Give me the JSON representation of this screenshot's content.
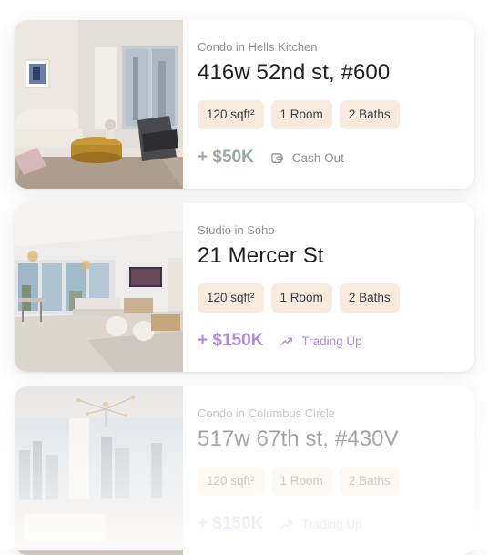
{
  "listings": [
    {
      "type": "Condo in Hells Kitchen",
      "address": "416w 52nd st, #600",
      "area": "120 sqft²",
      "rooms": "1 Room",
      "baths": "2 Baths",
      "amount": "+ $50K",
      "action": "Cash Out",
      "action_icon": "wallet-icon",
      "accent": "#94aa9b"
    },
    {
      "type": "Studio in Soho",
      "address": "21 Mercer St",
      "area": "120 sqft²",
      "rooms": "1 Room",
      "baths": "2 Baths",
      "amount": "+ $150K",
      "action": "Trading Up",
      "action_icon": "trending-up-icon",
      "accent": "#a98ddf"
    },
    {
      "type": "Condo in Columbus Circle",
      "address": "517w 67th st, #430V",
      "area": "120 sqft²",
      "rooms": "1 Room",
      "baths": "2 Baths",
      "amount": "+ $150K",
      "action": "Trading Up",
      "action_icon": "trending-up-icon",
      "accent": "#a98ddf"
    }
  ],
  "colors": {
    "chip_background": "#f8ebdd",
    "cash_out_green": "#94aa9b",
    "trading_up_purple": "#a98ddf"
  }
}
